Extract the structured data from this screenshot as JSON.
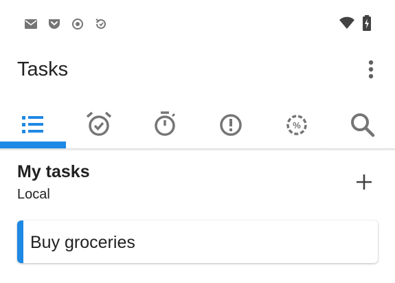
{
  "status_bar": {
    "left_icons": [
      "mail-icon",
      "pocket-icon",
      "record-icon",
      "sync-icon"
    ],
    "right_icons": [
      "wifi-icon",
      "battery-charging-icon"
    ]
  },
  "app_bar": {
    "title": "Tasks",
    "menu_icon": "more-vert-icon"
  },
  "tabs": [
    {
      "icon": "list-icon",
      "selected": true
    },
    {
      "icon": "alarm-icon",
      "selected": false
    },
    {
      "icon": "timer-icon",
      "selected": false
    },
    {
      "icon": "priority-icon",
      "selected": false
    },
    {
      "icon": "progress-percent-icon",
      "selected": false
    },
    {
      "icon": "search-icon",
      "selected": false
    }
  ],
  "list": {
    "title": "My tasks",
    "subtitle": "Local",
    "add_icon": "add-icon",
    "tasks": [
      {
        "title": "Buy groceries"
      }
    ]
  },
  "colors": {
    "accent": "#1e88e5",
    "icon_gray": "#757575"
  }
}
